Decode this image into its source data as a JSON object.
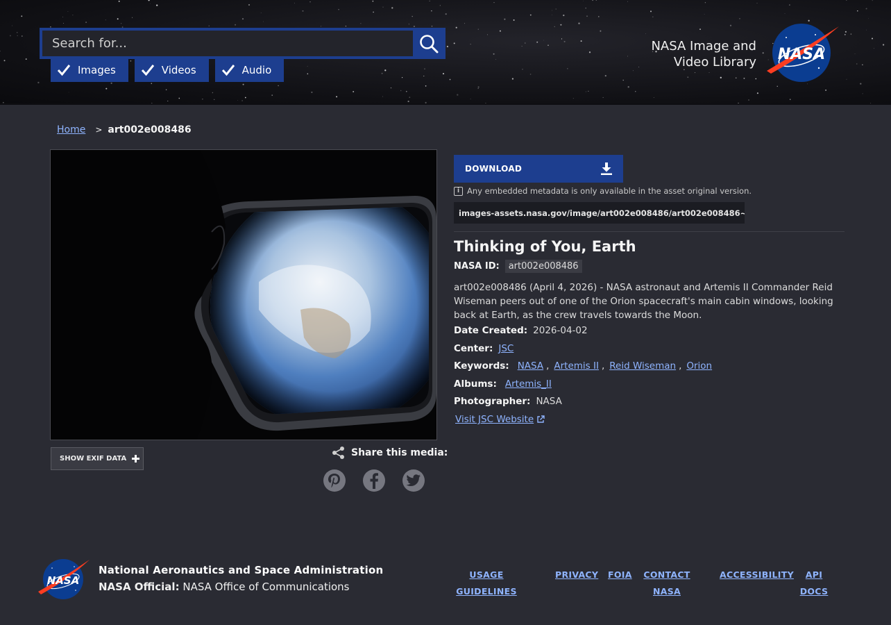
{
  "header": {
    "search_placeholder": "Search for...",
    "filters": [
      {
        "label": "Images",
        "checked": true
      },
      {
        "label": "Videos",
        "checked": true
      },
      {
        "label": "Audio",
        "checked": true
      }
    ],
    "site_title_line1": "NASA Image and",
    "site_title_line2": "Video Library",
    "logo_text": "NASA"
  },
  "breadcrumb": {
    "home": "Home",
    "separator": ">",
    "current": "art002e008486"
  },
  "media": {
    "exif_button": "SHOW EXIF DATA",
    "share_label": "Share this media:",
    "share_icons": [
      "pinterest-icon",
      "facebook-icon",
      "twitter-icon"
    ]
  },
  "asset": {
    "download_label": "DOWNLOAD",
    "metadata_note": "Any embedded metadata is only available in the asset original version.",
    "original_url": "images-assets.nasa.gov/image/art002e008486/art002e008486~orig.jpg",
    "title": "Thinking of You, Earth",
    "nasa_id_label": "NASA ID:",
    "nasa_id": "art002e008486",
    "description": "art002e008486 (April 4, 2026) - NASA astronaut and Artemis II Commander Reid Wiseman peers out of one of the Orion spacecraft's main cabin windows, looking back at Earth, as the crew travels towards the Moon.",
    "date_created_label": "Date Created:",
    "date_created": "2026-04-02",
    "center_label": "Center:",
    "center": "JSC",
    "keywords_label": "Keywords:",
    "keywords": [
      "NASA",
      "Artemis II",
      "Reid Wiseman",
      "Orion"
    ],
    "albums_label": "Albums:",
    "album": "Artemis_II",
    "photographer_label": "Photographer:",
    "photographer": "NASA",
    "visit_link": "Visit JSC Website"
  },
  "footer": {
    "org": "National Aeronautics and Space Administration",
    "official_label": "NASA Official:",
    "official_value": "NASA Office of Communications",
    "links": {
      "usage_1": "USAGE",
      "usage_2": "GUIDELINES",
      "privacy": "PRIVACY",
      "foia": "FOIA",
      "contact_1": "CONTACT",
      "contact_2": "NASA",
      "accessibility": "ACCESSIBILITY",
      "api_1": "API",
      "api_2": "DOCS"
    }
  },
  "colors": {
    "accent_blue": "#1d3e8f",
    "link": "#8fb4ff",
    "background": "#2a2b33"
  }
}
